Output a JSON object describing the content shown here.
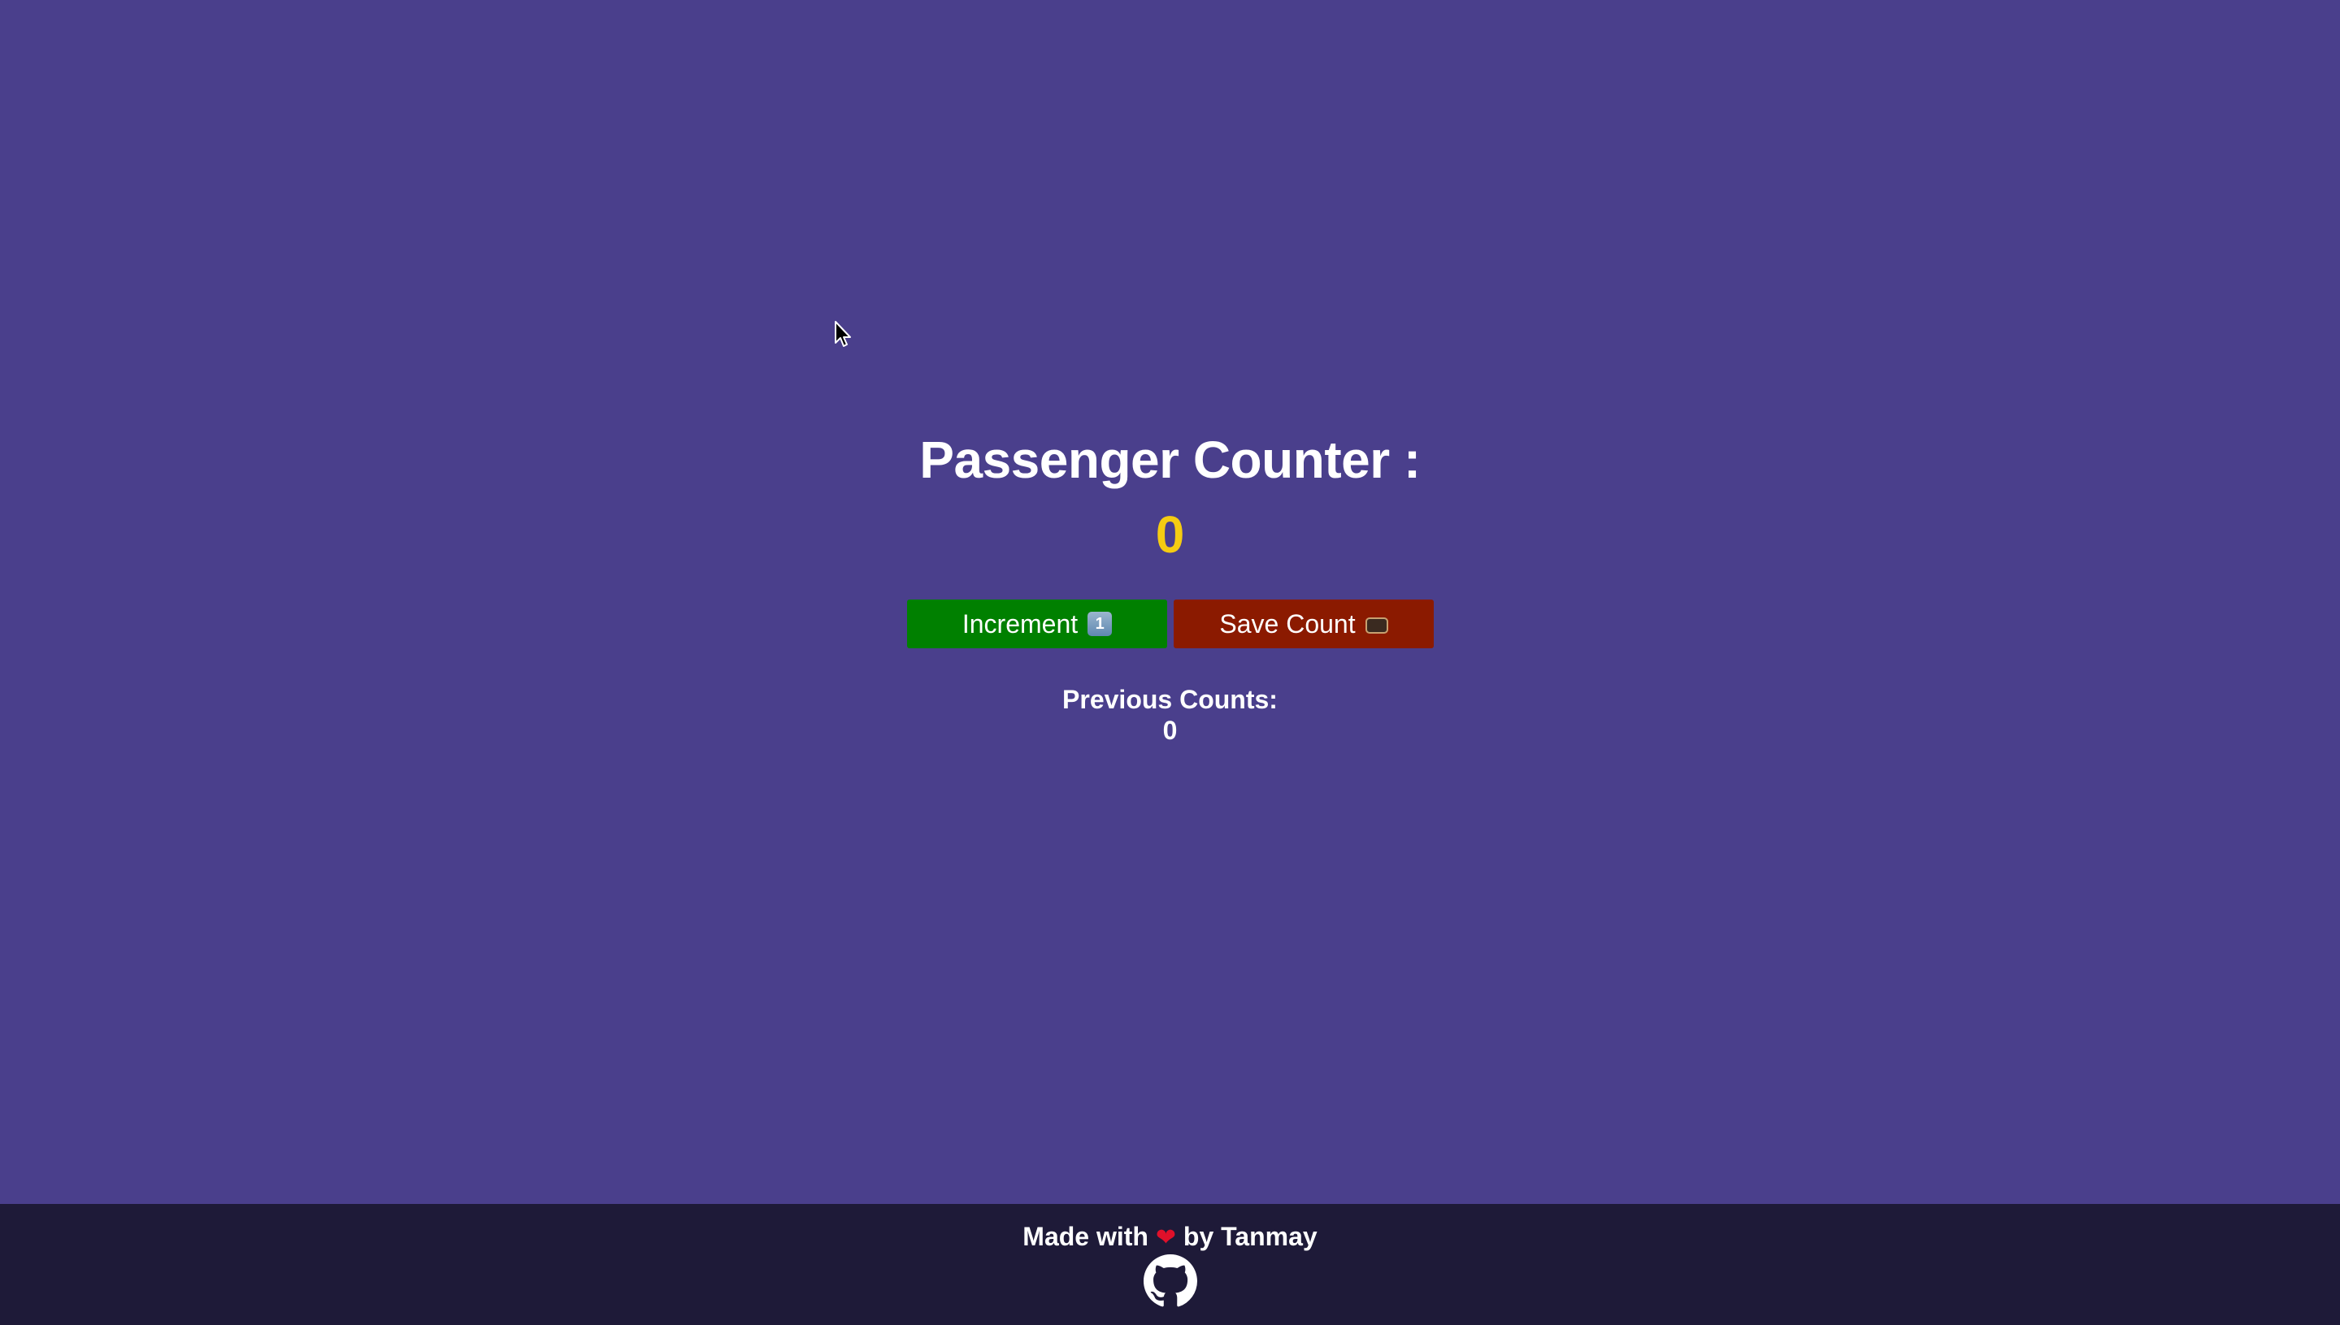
{
  "counter": {
    "title": "Passenger Counter :",
    "value": "0"
  },
  "buttons": {
    "increment_label": "Increment",
    "increment_emoji": "1",
    "increment_icon": "keycap-1-icon",
    "save_label": "Save Count",
    "save_icon": "card-box-icon"
  },
  "previous": {
    "label": "Previous Counts:",
    "value": "0"
  },
  "footer": {
    "text_before": "Made with",
    "heart": "❤",
    "text_after": "by Tanmay",
    "link_icon": "github-icon"
  },
  "colors": {
    "background": "#4a3f8c",
    "footer": "#1e1a38",
    "counter_value": "#f5cc12",
    "increment_button": "#008000",
    "save_button": "#8b1a00"
  }
}
